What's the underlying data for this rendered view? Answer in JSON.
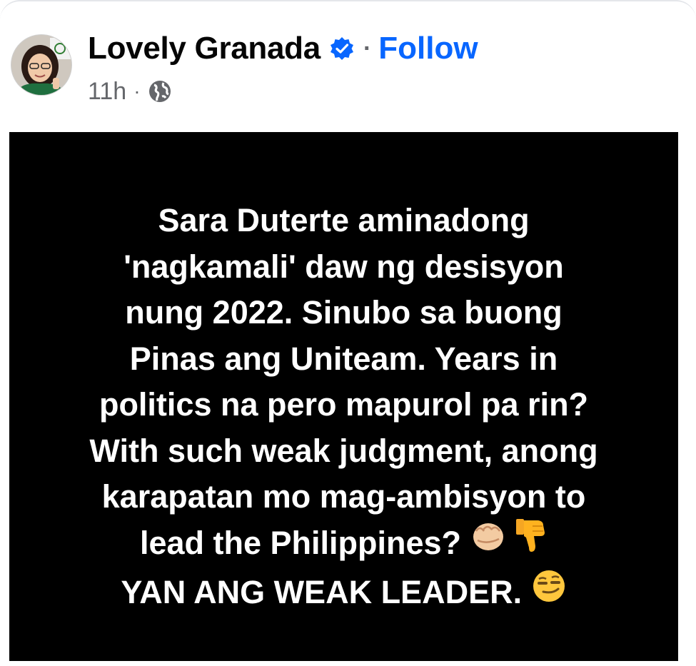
{
  "post": {
    "author": "Lovely Granada",
    "follow_label": "Follow",
    "separator": "·",
    "timestamp": "11h",
    "privacy_icon": "globe-icon",
    "verified_icon": "verified-badge-icon",
    "content_lines": [
      "Sara Duterte aminadong",
      "'nagkamali' daw ng desisyon",
      "nung 2022. Sinubo sa buong",
      "Pinas ang Uniteam. Years in",
      "politics na pero mapurol pa rin?",
      "With such weak judgment, anong",
      "karapatan mo mag-ambisyon to",
      "lead the Philippines?",
      "YAN ANG WEAK LEADER."
    ],
    "line8_emojis": [
      "oncoming-fist-emoji",
      "thumbs-down-emoji"
    ],
    "line9_emoji": "smirking-face-emoji"
  },
  "colors": {
    "follow": "#0866ff",
    "verified": "#0866ff",
    "meta": "#65676b",
    "post_background": "#000000",
    "post_text": "#ffffff"
  }
}
